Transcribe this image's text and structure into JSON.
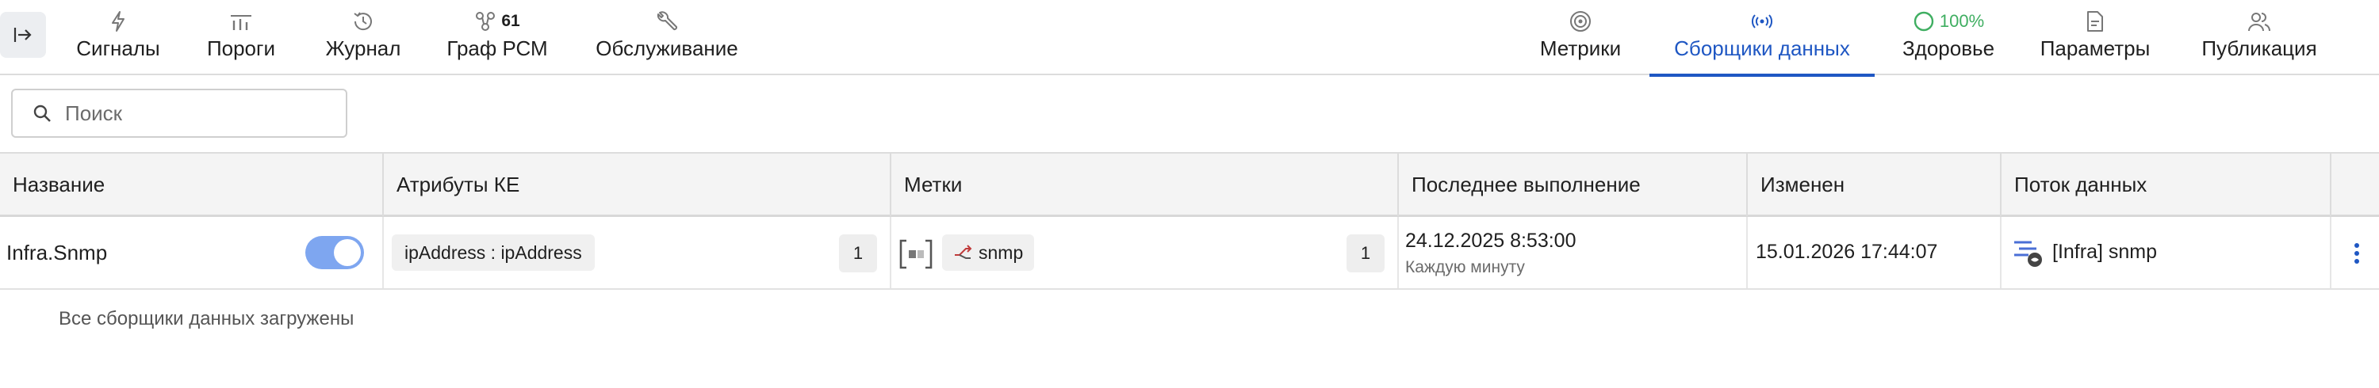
{
  "nav": {
    "left_tabs": [
      {
        "label": "Сигналы",
        "icon": "lightning-icon"
      },
      {
        "label": "Пороги",
        "icon": "thresholds-icon"
      },
      {
        "label": "Журнал",
        "icon": "history-icon"
      },
      {
        "label": "Граф РСМ",
        "icon": "graph-icon",
        "badge": "61"
      },
      {
        "label": "Обслуживание",
        "icon": "wrench-icon"
      }
    ],
    "right_tabs": [
      {
        "label": "Метрики",
        "icon": "metrics-icon"
      },
      {
        "label": "Сборщики данных",
        "icon": "signal-icon",
        "active": true
      },
      {
        "label": "Здоровье",
        "icon": "health-ring-icon",
        "badge": "100%",
        "health_level_percent": 100
      },
      {
        "label": "Параметры",
        "icon": "document-icon"
      },
      {
        "label": "Публикация",
        "icon": "users-icon"
      }
    ]
  },
  "search": {
    "placeholder": "Поиск"
  },
  "table": {
    "columns": [
      "Название",
      "Атрибуты КЕ",
      "Метки",
      "Последнее выполнение",
      "Изменен",
      "Поток данных"
    ],
    "rows": [
      {
        "name": "Infra.Snmp",
        "enabled": true,
        "attribute": "ipAddress : ipAddress",
        "attribute_count": "1",
        "label": "snmp",
        "label_count": "1",
        "last_run": "24.12.2025 8:53:00",
        "schedule": "Каждую минуту",
        "modified": "15.01.2026 17:44:07",
        "data_flow": "[Infra] snmp"
      }
    ]
  },
  "footer": {
    "status": "Все сборщики данных загружены"
  },
  "colors": {
    "accent": "#1f57c3",
    "toggle_on": "#7ea6f0",
    "health": "#3fae61"
  }
}
